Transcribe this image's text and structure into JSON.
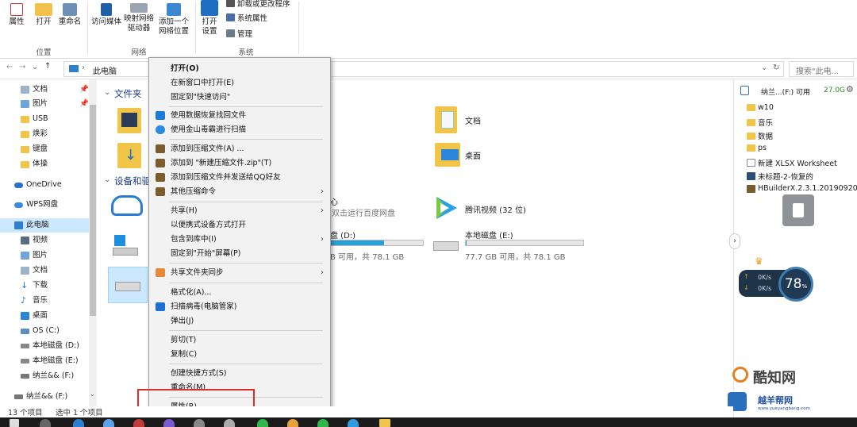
{
  "ribbon": {
    "properties": "属性",
    "open": "打开",
    "rename": "重命名",
    "access_media": "访问媒体",
    "map_drive_1": "映射网络",
    "map_drive_2": "驱动器",
    "add_loc_1": "添加一个",
    "add_loc_2": "网络位置",
    "open_settings_1": "打开",
    "open_settings_2": "设置",
    "uninstall": "卸载或更改程序",
    "system_props": "系统属性",
    "manage": "管理",
    "group_location": "位置",
    "group_network": "网络",
    "group_system": "系统"
  },
  "address": {
    "path": "此电脑",
    "search_placeholder": "搜索\"此电..."
  },
  "nav": {
    "items": [
      {
        "label": "文档",
        "pinned": true
      },
      {
        "label": "图片",
        "pinned": true
      },
      {
        "label": "USB"
      },
      {
        "label": "焕彩"
      },
      {
        "label": "键盘"
      },
      {
        "label": "体操"
      },
      {
        "label": "OneDrive"
      },
      {
        "label": "WPS网盘"
      },
      {
        "label": "此电脑",
        "selected": true
      },
      {
        "label": "视频"
      },
      {
        "label": "图片"
      },
      {
        "label": "文档"
      },
      {
        "label": "下载"
      },
      {
        "label": "音乐"
      },
      {
        "label": "桌面"
      },
      {
        "label": "OS (C:)"
      },
      {
        "label": "本地磁盘 (D:)"
      },
      {
        "label": "本地磁盘 (E:)"
      },
      {
        "label": "纳兰&& (F:)"
      },
      {
        "label": "纳兰&& (F:)"
      }
    ]
  },
  "content": {
    "folders_header": "文件夹",
    "devices_header": "设备和驱",
    "folders": [
      {
        "label": "文档"
      },
      {
        "label": "桌面"
      }
    ],
    "cloud_sub": "双击运行百度网盘",
    "cloud_letter": "心",
    "tencent_video": "腾讯视频 (32 位)",
    "drive_d": {
      "label": "盘 (D:)",
      "detail": "B 可用，共 78.1 GB",
      "used_fraction": 0.58
    },
    "drive_e": {
      "label": "本地磁盘 (E:)",
      "detail": "77.7 GB 可用，共 78.1 GB",
      "used_fraction": 0.005
    }
  },
  "menu": {
    "items": [
      {
        "label": "打开(O)",
        "bold": true
      },
      {
        "label": "在新窗口中打开(E)"
      },
      {
        "label": "固定到\"快速访问\""
      },
      {
        "label": "使用数据恢复找回文件",
        "icon": "recovery-icon"
      },
      {
        "label": "使用金山毒霸进行扫描",
        "icon": "duba-icon"
      },
      {
        "label": "添加到压缩文件(A) ...",
        "icon": "archive-icon"
      },
      {
        "label": "添加到 \"新建压缩文件.zip\"(T)",
        "icon": "archive-icon"
      },
      {
        "label": "添加到压缩文件并发送给QQ好友",
        "icon": "archive-icon"
      },
      {
        "label": "其他压缩命令",
        "icon": "archive-icon",
        "submenu": true
      },
      {
        "label": "共享(H)",
        "submenu": true
      },
      {
        "label": "以便携式设备方式打开"
      },
      {
        "label": "包含到库中(I)",
        "submenu": true
      },
      {
        "label": "固定到\"开始\"屏幕(P)"
      },
      {
        "label": "共享文件夹同步",
        "icon": "sync-icon",
        "submenu": true
      },
      {
        "label": "格式化(A)..."
      },
      {
        "label": "扫描病毒(电脑管家)",
        "icon": "shield-icon"
      },
      {
        "label": "弹出(J)"
      },
      {
        "label": "剪切(T)"
      },
      {
        "label": "复制(C)"
      },
      {
        "label": "创建快捷方式(S)"
      },
      {
        "label": "重命名(M)"
      },
      {
        "label": "属性(R)"
      }
    ]
  },
  "right_panel": {
    "drive": "纳兰...(F:) 可用",
    "free": "27.0G",
    "files": [
      {
        "label": "w10",
        "type": "folder"
      },
      {
        "label": "音乐",
        "type": "folder"
      },
      {
        "label": "数据",
        "type": "folder"
      },
      {
        "label": "ps",
        "type": "folder"
      },
      {
        "label": "新建 XLSX Worksheet",
        "type": "xlsx"
      },
      {
        "label": "未标题-2-恢复的",
        "type": "psd"
      },
      {
        "label": "HBuilderX.2.3.1.20190920",
        "type": "archive"
      }
    ],
    "speed_up": "0K/s",
    "speed_down": "0K/s",
    "percent": "78",
    "percent_unit": "%"
  },
  "status": {
    "count": "13 个项目",
    "selected": "选中 1 个项目"
  },
  "watermark": {
    "brand1": "酷知网",
    "brand2": "越羊帮网",
    "url": "www.yueyangbang.com"
  }
}
